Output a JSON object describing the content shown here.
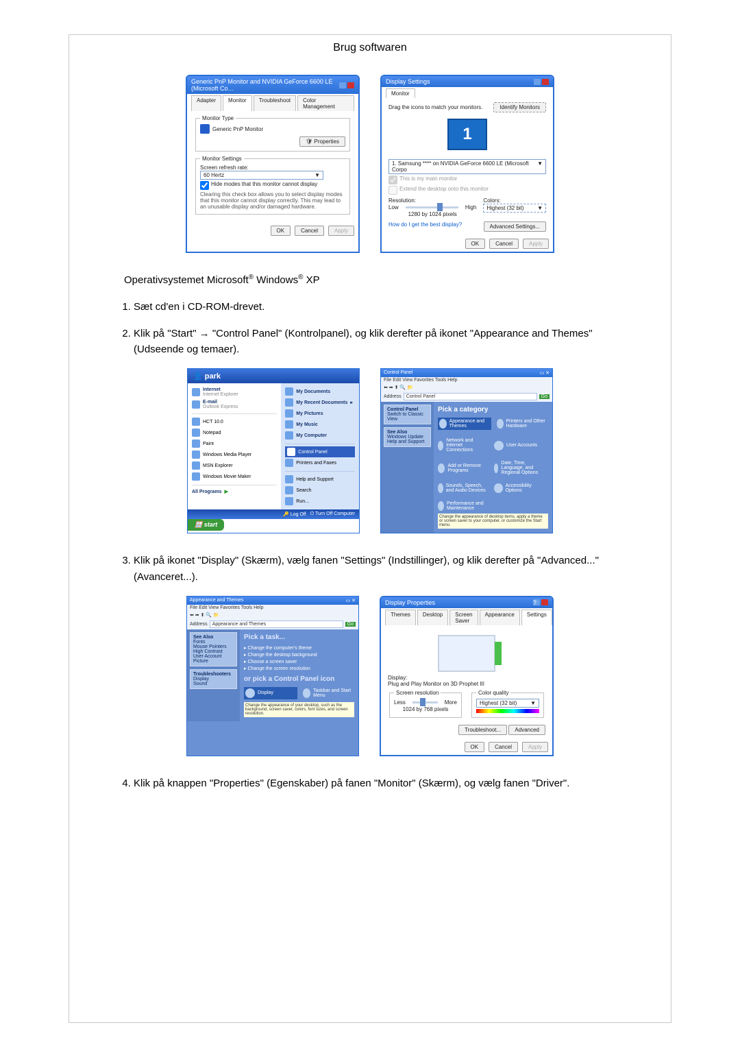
{
  "page": {
    "title": "Brug softwaren",
    "os_line_prefix": "Operativsystemet Microsoft",
    "os_line_mid": " Windows",
    "os_line_suffix": " XP"
  },
  "steps": {
    "s1": "Sæt cd'en i CD-ROM-drevet.",
    "s2": "Klik på \"Start\" → \"Control Panel\" (Kontrolpanel), og klik derefter på ikonet \"Appearance and Themes\" (Udseende og temaer).",
    "s3": "Klik på ikonet \"Display\" (Skærm), vælg fanen \"Settings\" (Indstillinger), og klik derefter på \"Advanced...\" (Avanceret...).",
    "s4": "Klik på knappen \"Properties\" (Egenskaber) på fanen \"Monitor\" (Skærm), og vælg fanen \"Driver\"."
  },
  "monitor_win": {
    "title": "Generic PnP Monitor and NVIDIA GeForce 6600 LE (Microsoft Co…",
    "tabs": {
      "adapter": "Adapter",
      "monitor": "Monitor",
      "troubleshoot": "Troubleshoot",
      "cm": "Color Management"
    },
    "type_legend": "Monitor Type",
    "type_value": "Generic PnP Monitor",
    "properties_btn": "Properties",
    "settings_legend": "Monitor Settings",
    "refresh_label": "Screen refresh rate:",
    "refresh_value": "60 Hertz",
    "hide_cb": "Hide modes that this monitor cannot display",
    "hide_note": "Clearing this check box allows you to select display modes that this monitor cannot display correctly. This may lead to an unusable display and/or damaged hardware.",
    "ok": "OK",
    "cancel": "Cancel",
    "apply": "Apply"
  },
  "ds_win": {
    "title": "Display Settings",
    "tab": "Monitor",
    "drag_text": "Drag the icons to match your monitors.",
    "identify": "Identify Monitors",
    "combo": "1. Samsung **** on NVIDIA GeForce 6600 LE (Microsoft Corpo",
    "main_cb": "This is my main monitor",
    "extend_cb": "Extend the desktop onto this monitor",
    "res_label": "Resolution:",
    "low": "Low",
    "high": "High",
    "res_value": "1280 by 1024 pixels",
    "colors_label": "Colors:",
    "colors_value": "Highest (32 bit)",
    "help_link": "How do I get the best display?",
    "adv": "Advanced Settings...",
    "ok": "OK",
    "cancel": "Cancel",
    "apply": "Apply"
  },
  "xp_start": {
    "user": "park",
    "left": {
      "internet": "Internet",
      "internet_sub": "Internet Explorer",
      "email": "E-mail",
      "email_sub": "Outlook Express",
      "hct": "HCT 10.0",
      "notepad": "Notepad",
      "paint": "Paint",
      "wmp": "Windows Media Player",
      "msn": "MSN Explorer",
      "wmm": "Windows Movie Maker",
      "all_programs": "All Programs"
    },
    "right": {
      "my_docs": "My Documents",
      "recent": "My Recent Documents",
      "pics": "My Pictures",
      "music": "My Music",
      "computer": "My Computer",
      "cp": "Control Panel",
      "printers": "Printers and Faxes",
      "help": "Help and Support",
      "search": "Search",
      "run": "Run..."
    },
    "foot": {
      "logoff": "Log Off",
      "shutdown": "Turn Off Computer"
    },
    "start": "start"
  },
  "cp1": {
    "title": "Control Panel",
    "menu": "File   Edit   View   Favorites   Tools   Help",
    "address_label": "Address",
    "address": "Control Panel",
    "side": {
      "switch": "Switch to Classic View",
      "see": "See Also",
      "wu": "Windows Update",
      "hs": "Help and Support"
    },
    "main_head": "Pick a category",
    "cats": {
      "appearance": "Appearance and Themes",
      "printers": "Printers and Other Hardware",
      "network": "Network and Internet Connections",
      "users": "User Accounts",
      "addremove": "Add or Remove Programs",
      "region": "Date, Time, Language, and Regional Options",
      "sounds": "Sounds, Speech, and Audio Devices",
      "access": "Accessibility Options",
      "perf": "Performance and Maintenance"
    },
    "app_desc": "Change the appearance of desktop items, apply a theme or screen saver to your computer, or customize the Start menu."
  },
  "cp2": {
    "title": "Appearance and Themes",
    "menu": "File   Edit   View   Favorites   Tools   Help",
    "address": "Appearance and Themes",
    "side": {
      "see": "See Also",
      "fonts": "Fonts",
      "mouse": "Mouse Pointers",
      "hc": "High Contrast",
      "ua": "User Account Picture",
      "ts": "Troubleshooters",
      "disp": "Display",
      "sound": "Sound"
    },
    "main_head": "Pick a task...",
    "tasks": {
      "t1": "Change the computer's theme",
      "t2": "Change the desktop background",
      "t3": "Choose a screen saver",
      "t4": "Change the screen resolution"
    },
    "or_head": "or pick a Control Panel icon",
    "icons": {
      "display": "Display",
      "taskbar": "Taskbar and Start Menu"
    },
    "icon_desc": "Change the appearance of your desktop, such as the background, screen saver, colors, font sizes, and screen resolution."
  },
  "dp_win": {
    "title": "Display Properties",
    "tabs": {
      "themes": "Themes",
      "desktop": "Desktop",
      "ss": "Screen Saver",
      "app": "Appearance",
      "settings": "Settings"
    },
    "display_label": "Display:",
    "display_value": "Plug and Play Monitor on 3D Prophet III",
    "res_legend": "Screen resolution",
    "less": "Less",
    "more": "More",
    "res_value": "1024 by 768 pixels",
    "cq_legend": "Color quality",
    "cq_value": "Highest (32 bit)",
    "tshoot": "Troubleshoot...",
    "adv": "Advanced",
    "ok": "OK",
    "cancel": "Cancel",
    "apply": "Apply"
  }
}
